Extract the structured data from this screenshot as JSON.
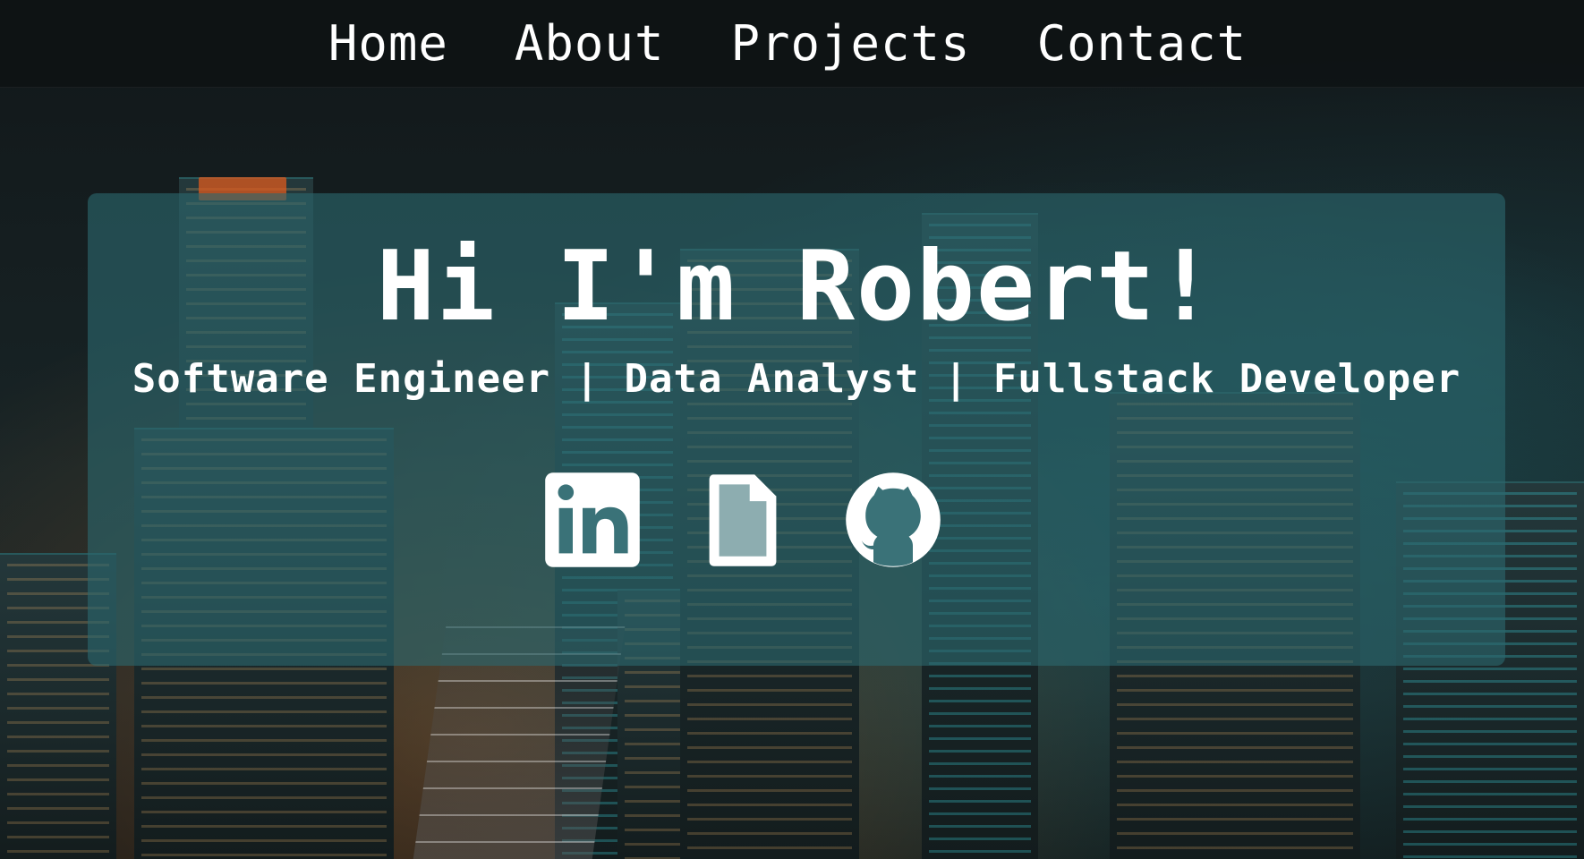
{
  "nav": {
    "items": [
      {
        "label": "Home"
      },
      {
        "label": "About"
      },
      {
        "label": "Projects"
      },
      {
        "label": "Contact"
      }
    ]
  },
  "hero": {
    "title": "Hi I'm Robert!",
    "subtitle": "Software Engineer | Data Analyst | Fullstack Developer",
    "socials": [
      {
        "icon": "linkedin-icon"
      },
      {
        "icon": "resume-file-icon"
      },
      {
        "icon": "github-icon"
      }
    ]
  },
  "colors": {
    "card": "#2c686e",
    "text": "#ffffff",
    "nav_bg": "#0e1214"
  }
}
